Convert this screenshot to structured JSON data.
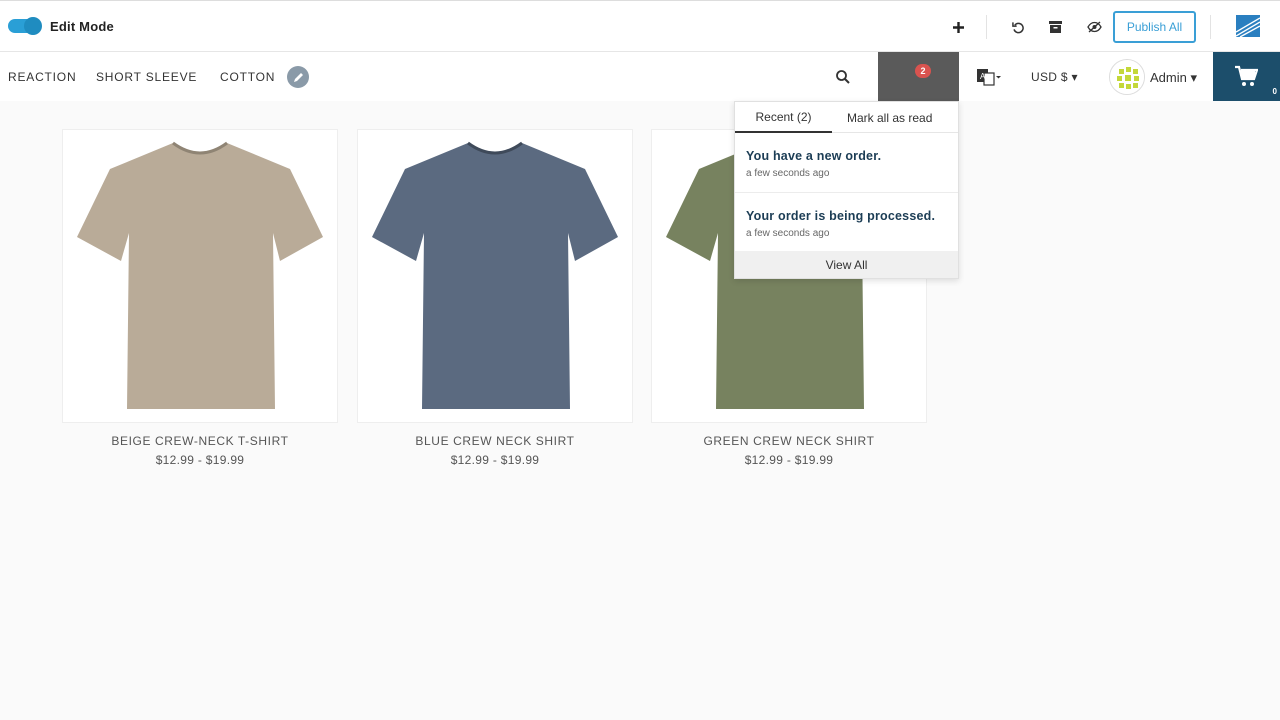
{
  "admin_bar": {
    "edit_mode_label": "Edit Mode",
    "edit_mode_on": true,
    "publish_label": "Publish All",
    "icons": [
      "plus-icon",
      "undo-icon",
      "archive-icon",
      "eye-slash-icon"
    ]
  },
  "navbar": {
    "tags": [
      "REACTION",
      "SHORT SLEEVE",
      "COTTON"
    ],
    "notification_count": "2",
    "currency": "USD $",
    "user": "Admin",
    "cart_count": "0"
  },
  "notifications": {
    "tab_label": "Recent (2)",
    "mark_all_label": "Mark all as read",
    "items": [
      {
        "title": "You have a new order.",
        "time": "a few seconds ago"
      },
      {
        "title": "Your order is being processed.",
        "time": "a few seconds ago"
      }
    ],
    "view_all_label": "View All"
  },
  "products": [
    {
      "name": "BEIGE CREW-NECK T-SHIRT",
      "price": "$12.99 - $19.99",
      "color": "#b9ab98"
    },
    {
      "name": "BLUE CREW NECK SHIRT",
      "price": "$12.99 - $19.99",
      "color": "#5b6a80"
    },
    {
      "name": "GREEN CREW NECK SHIRT",
      "price": "$12.99 - $19.99",
      "color": "#77825f"
    }
  ],
  "colors": {
    "accent": "#2a9fd6",
    "cart": "#1c4e6b",
    "badge": "#d9534f",
    "notif_bg": "#5a5a5a"
  }
}
